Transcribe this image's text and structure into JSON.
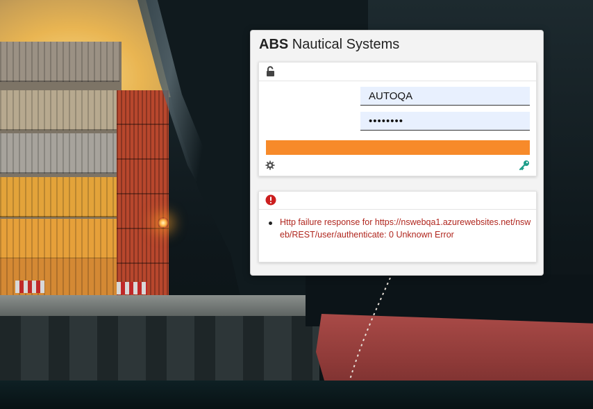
{
  "app": {
    "title_brand": "ABS",
    "title_rest": " Nautical Systems"
  },
  "login": {
    "username_value": "AUTOQA",
    "password_value": "••••••••",
    "login_button_color": "#f78a2a",
    "icons": {
      "header": "lock-open-icon",
      "settings": "gear-icon",
      "password_reset": "key-icon"
    }
  },
  "error": {
    "icon": "error-icon",
    "messages": [
      "Http failure response for https://nswebqa1.azurewebsites.net/nsweb/REST/user/authenticate: 0 Unknown Error"
    ],
    "text_color": "#b0261e"
  },
  "colors": {
    "accent": "#f78a2a",
    "error": "#cc1f1f",
    "key_icon": "#1f9e8a"
  }
}
